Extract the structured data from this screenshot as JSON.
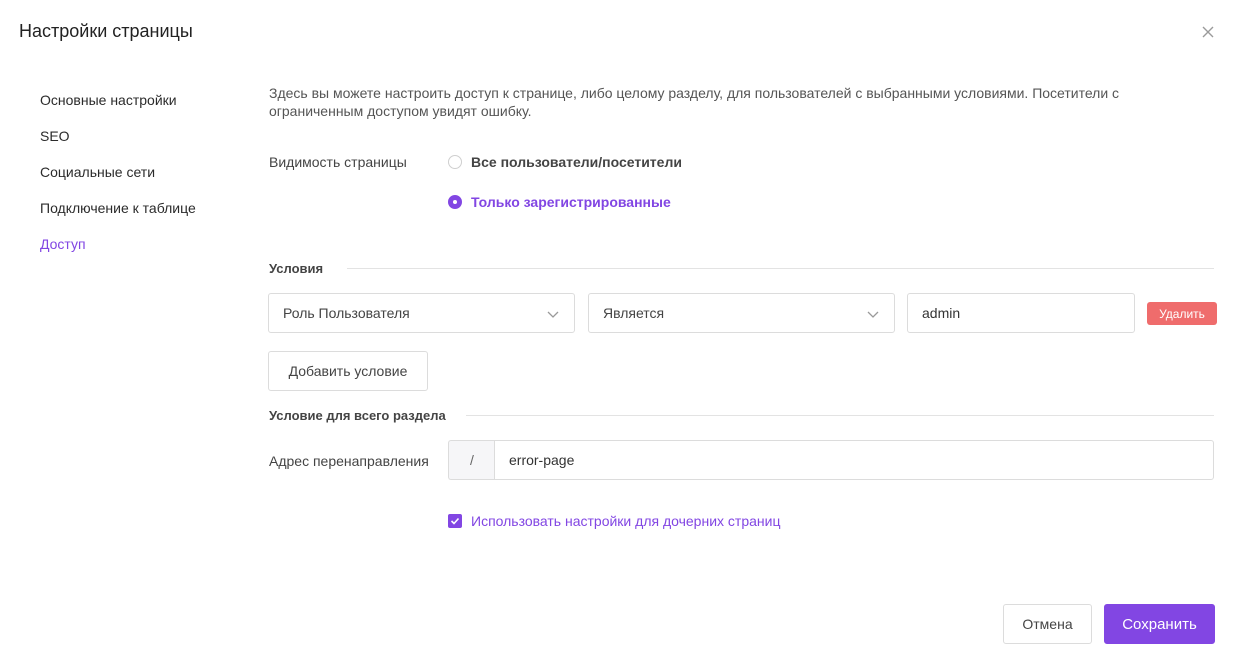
{
  "dialog": {
    "title": "Настройки страницы"
  },
  "sidebar": {
    "items": [
      {
        "label": "Основные настройки",
        "active": false
      },
      {
        "label": "SEO",
        "active": false
      },
      {
        "label": "Социальные сети",
        "active": false
      },
      {
        "label": "Подключение к таблице",
        "active": false
      },
      {
        "label": "Доступ",
        "active": true
      }
    ]
  },
  "access": {
    "description": "Здесь вы можете настроить доступ к странице, либо целому разделу, для пользователей с выбранными условиями. Посетители с ограниченным доступом увидят ошибку.",
    "visibility_label": "Видимость страницы",
    "visibility_options": [
      {
        "label": "Все пользователи/посетители",
        "checked": false
      },
      {
        "label": "Только зарегистрированные",
        "checked": true
      }
    ],
    "conditions_title": "Условия",
    "condition": {
      "field": "Роль Пользователя",
      "operator": "Является",
      "value": "admin",
      "delete_label": "Удалить"
    },
    "add_condition_label": "Добавить условие",
    "section_condition_title": "Условие для всего раздела",
    "redirect_label": "Адрес перенаправления",
    "redirect_prefix": "/",
    "redirect_value": "error-page",
    "child_pages_label": "Использовать настройки для дочерних страниц",
    "child_pages_checked": true
  },
  "footer": {
    "cancel_label": "Отмена",
    "save_label": "Сохранить"
  },
  "colors": {
    "accent": "#8246e3",
    "danger": "#ef6c6c"
  }
}
